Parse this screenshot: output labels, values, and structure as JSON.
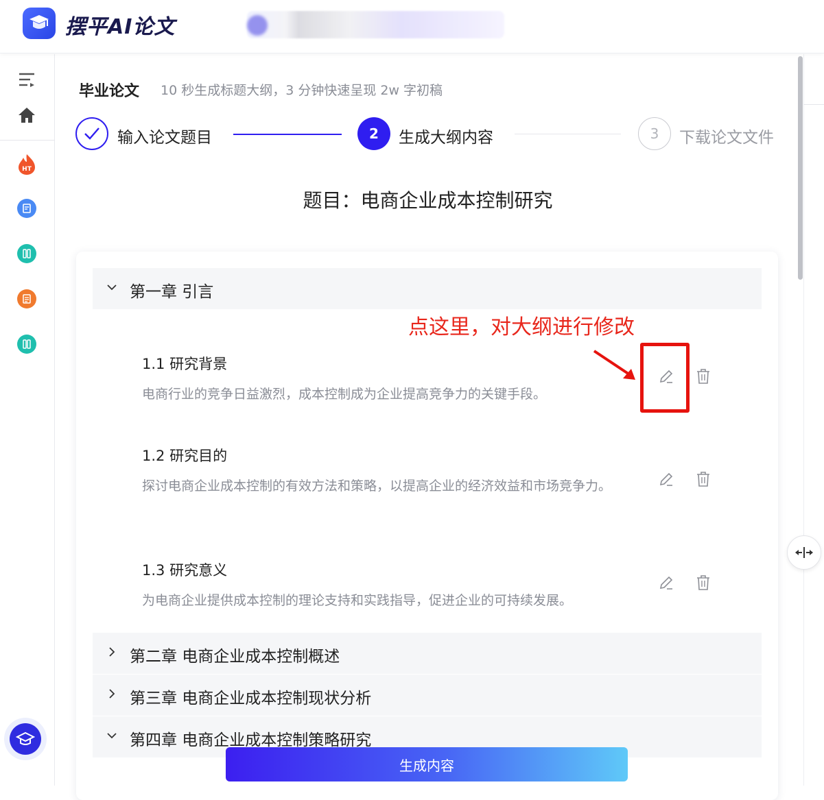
{
  "app": {
    "brand": "摆平AI论文",
    "user_redacted": ""
  },
  "sidebar": {
    "items": [
      {
        "icon": "menu-collapse-icon"
      },
      {
        "icon": "home-icon"
      },
      {
        "icon": "hot-topics-icon",
        "badge": "HT",
        "color": "#f0552b"
      },
      {
        "icon": "document-icon",
        "color": "#4a8af4"
      },
      {
        "icon": "tool-icon",
        "color": "#1fbfae"
      },
      {
        "icon": "report-icon",
        "color": "#f07a2e"
      },
      {
        "icon": "tool-icon-2",
        "color": "#1fbfae"
      }
    ]
  },
  "page": {
    "title": "毕业论文",
    "subtitle": "10 秒生成标题大纲，3 分钟快速呈现 2w 字初稿"
  },
  "steps": [
    {
      "number": "",
      "label": "输入论文题目",
      "state": "done"
    },
    {
      "number": "2",
      "label": "生成大纲内容",
      "state": "active"
    },
    {
      "number": "3",
      "label": "下载论文文件",
      "state": "pending"
    }
  ],
  "topic": "题目：电商企业成本控制研究",
  "outline": {
    "chapters": [
      {
        "label": "第一章 引言",
        "expanded": true,
        "sections": [
          {
            "title": "1.1 研究背景",
            "desc": "电商行业的竞争日益激烈，成本控制成为企业提高竞争力的关键手段。"
          },
          {
            "title": "1.2 研究目的",
            "desc": "探讨电商企业成本控制的有效方法和策略，以提高企业的经济效益和市场竞争力。"
          },
          {
            "title": "1.3 研究意义",
            "desc": "为电商企业提供成本控制的理论支持和实践指导，促进企业的可持续发展。"
          }
        ]
      },
      {
        "label": "第二章 电商企业成本控制概述",
        "expanded": false
      },
      {
        "label": "第三章 电商企业成本控制现状分析",
        "expanded": false
      },
      {
        "label": "第四章 电商企业成本控制策略研究",
        "expanded": true
      }
    ]
  },
  "annotation": "点这里，对大纲进行修改",
  "actions": {
    "generate": "生成内容"
  },
  "colors": {
    "accent": "#2f1ef0",
    "annotation": "#e8271c",
    "muted": "#8a8d96"
  }
}
